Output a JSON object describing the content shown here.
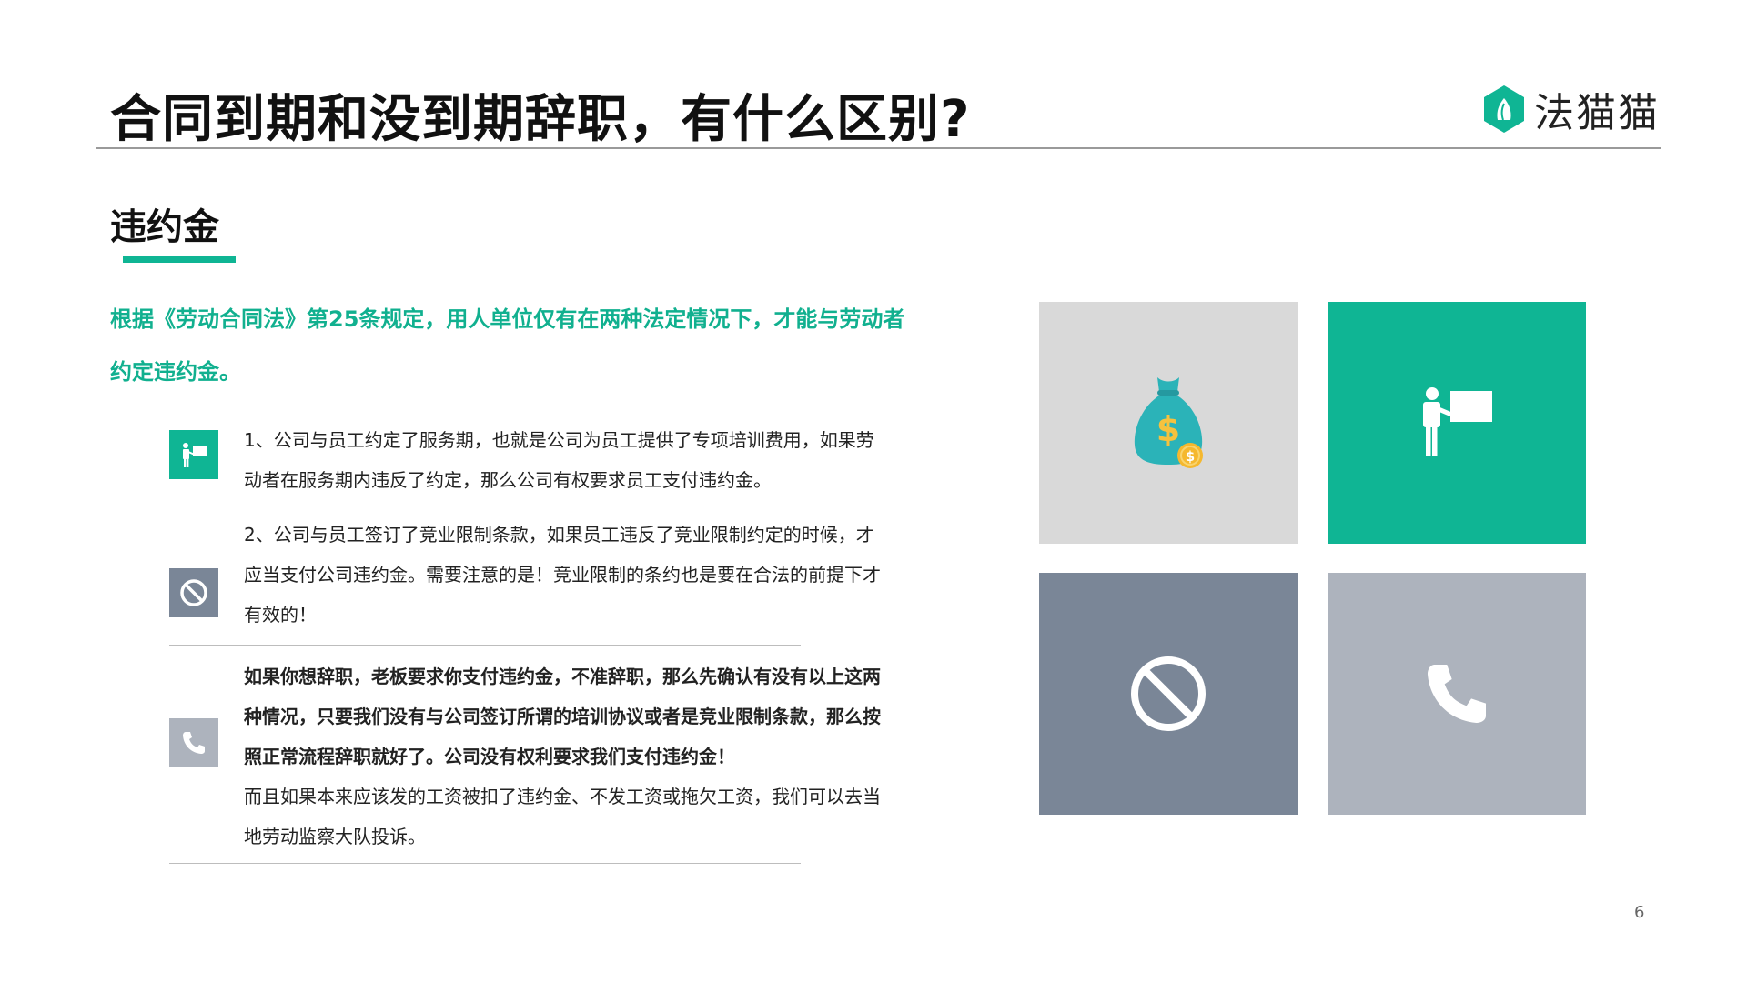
{
  "header": {
    "title": "合同到期和没到期辞职，有什么区别?",
    "brand": "法猫猫"
  },
  "section": {
    "heading": "违约金",
    "lead": "根据《劳动合同法》第25条规定，用人单位仅有在两种法定情况下，才能与劳动者约定违约金。"
  },
  "items": [
    {
      "icon": "presentation-icon",
      "text": "1、公司与员工约定了服务期，也就是公司为员工提供了专项培训费用，如果劳动者在服务期内违反了约定，那么公司有权要求员工支付违约金。"
    },
    {
      "icon": "prohibited-icon",
      "text": "2、公司与员工签订了竞业限制条款，如果员工违反了竞业限制约定的时候，才应当支付公司违约金。需要注意的是！竞业限制的条约也是要在合法的前提下才有效的！"
    },
    {
      "icon": "phone-icon",
      "bold_text": "如果你想辞职，老板要求你支付违约金，不准辞职，那么先确认有没有以上这两种情况，只要我们没有与公司签订所谓的培训协议或者是竞业限制条款，那么按照正常流程辞职就好了。公司没有权利要求我们支付违约金！",
      "text": "而且如果本来应该发的工资被扣了违约金、不发工资或拖欠工资，我们可以去当地劳动监察大队投诉。"
    }
  ],
  "tiles": [
    {
      "icon": "money-bag-icon",
      "color": "#d9d9d9"
    },
    {
      "icon": "presentation-icon",
      "color": "#0fb594"
    },
    {
      "icon": "prohibited-icon",
      "color": "#7a8697"
    },
    {
      "icon": "phone-icon",
      "color": "#adb3bd"
    }
  ],
  "colors": {
    "accent": "#0fb594",
    "slate": "#7a8697",
    "light_slate": "#adb3bd"
  },
  "page_number": "6"
}
